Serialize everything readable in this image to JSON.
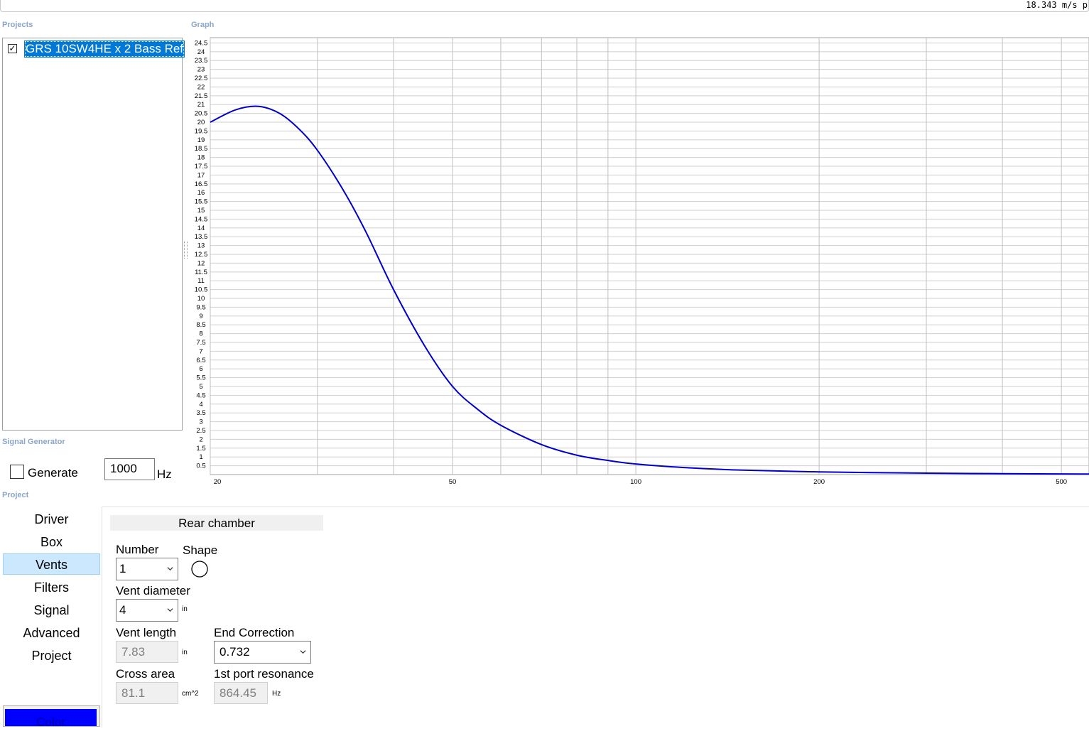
{
  "status": {
    "readout": "18.343 m/s p"
  },
  "sections": {
    "projects": "Projects",
    "graph": "Graph",
    "signal_generator": "Signal Generator",
    "project": "Project"
  },
  "projects": {
    "items": [
      {
        "label": "GRS 10SW4HE x 2 Bass Ref",
        "checked": true,
        "selected": true
      }
    ]
  },
  "signal_generator": {
    "generate_label": "Generate",
    "generate_checked": false,
    "frequency": "1000",
    "unit": "Hz"
  },
  "nav": {
    "items": [
      {
        "label": "Driver"
      },
      {
        "label": "Box"
      },
      {
        "label": "Vents",
        "active": true
      },
      {
        "label": "Filters"
      },
      {
        "label": "Signal"
      },
      {
        "label": "Advanced"
      },
      {
        "label": "Project"
      }
    ],
    "color_button": "Color",
    "color_value": "#0000ff"
  },
  "vents": {
    "tab": "Rear chamber",
    "number_label": "Number",
    "number_value": "1",
    "shape_label": "Shape",
    "shape_icon": "circle-icon",
    "diameter_label": "Vent diameter",
    "diameter_value": "4",
    "diameter_unit": "in",
    "length_label": "Vent length",
    "length_value": "7.83",
    "length_unit": "in",
    "end_correction_label": "End Correction",
    "end_correction_value": "0.732",
    "cross_area_label": "Cross area",
    "cross_area_value": "81.1",
    "cross_area_unit": "cm^2",
    "resonance_label": "1st port resonance",
    "resonance_value": "864.45",
    "resonance_unit": "Hz"
  },
  "chart_data": {
    "type": "line",
    "title": "",
    "xlabel": "",
    "ylabel": "",
    "x_scale": "log",
    "xlim": [
      20,
      555
    ],
    "ylim": [
      0,
      24.8
    ],
    "x_ticks": [
      20,
      50,
      100,
      200,
      500
    ],
    "y_ticks": [
      0.5,
      1,
      1.5,
      2,
      2.5,
      3,
      3.5,
      4,
      4.5,
      5,
      5.5,
      6,
      6.5,
      7,
      7.5,
      8,
      8.5,
      9,
      9.5,
      10,
      10.5,
      11,
      11.5,
      12,
      12.5,
      13,
      13.5,
      14,
      14.5,
      15,
      15.5,
      16,
      16.5,
      17,
      17.5,
      18,
      18.5,
      19,
      19.5,
      20,
      20.5,
      21,
      21.5,
      22,
      22.5,
      23,
      23.5,
      24,
      24.5
    ],
    "grid_x": [
      20,
      30,
      40,
      50,
      60,
      70,
      80,
      90,
      100,
      200,
      300,
      400,
      500
    ],
    "grid": true,
    "line_color": "#0000cc",
    "series": [
      {
        "x": [
          20,
          22,
          24,
          26,
          28,
          30,
          33,
          36,
          40,
          45,
          50,
          55,
          60,
          70,
          80,
          90,
          100,
          120,
          150,
          200,
          300,
          400,
          555
        ],
        "y": [
          20.0,
          20.7,
          20.9,
          20.5,
          19.6,
          18.4,
          16.2,
          13.8,
          10.5,
          7.3,
          5.0,
          3.7,
          2.8,
          1.7,
          1.1,
          0.8,
          0.6,
          0.4,
          0.25,
          0.15,
          0.08,
          0.05,
          0.03
        ]
      }
    ]
  }
}
